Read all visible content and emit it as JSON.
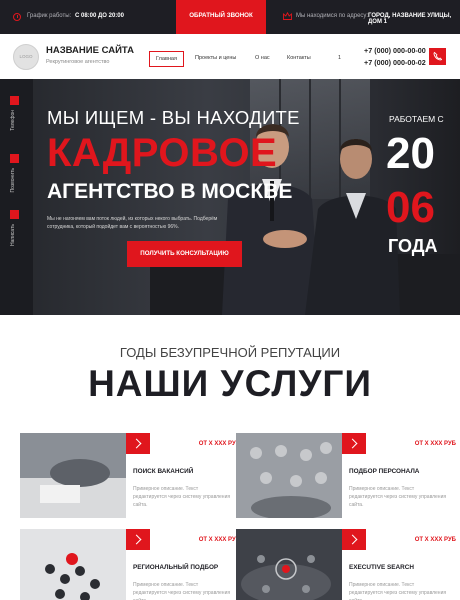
{
  "topbar": {
    "hours_label": "График работы:",
    "hours_value": "С 08:00 ДО 20:00",
    "callback_label": "ОБРАТНЫЙ ЗВОНОК",
    "location_label": "Мы находимся по адресу:",
    "location_value": "ГОРОД, НАЗВАНИЕ УЛИЦЫ, ДОМ 1"
  },
  "header": {
    "logo_text": "LOGO",
    "site_title": "НАЗВАНИЕ САЙТА",
    "site_subtitle": "Рекрутинговое агентство",
    "nav": [
      "Главная",
      "Проекты и цены",
      "О нас",
      "Контакты",
      "1"
    ],
    "phones": [
      "+7 (000) 000-00-00",
      "+7 (000) 000-00-02"
    ]
  },
  "side_rail": [
    "Телефон",
    "Позвонить",
    "Написать"
  ],
  "hero": {
    "line1": "МЫ ИЩЕМ - ВЫ НАХОДИТЕ",
    "line2": "КАДРОВОЕ",
    "line3": "АГЕНТСТВО В МОСКВЕ",
    "description": "Мы не нагоняем вам поток людей, из которых некого выбрать. Подберём сотрудника, который подойдет вам с вероятностью 96%.",
    "cta_label": "ПОЛУЧИТЬ КОНСУЛЬТАЦИЮ",
    "since_label": "РАБОТАЕМ С",
    "since_top": "20",
    "since_bottom": "06",
    "since_suffix": "ГОДА"
  },
  "services": {
    "kicker": "ГОДЫ БЕЗУПРЕЧНОЙ РЕПУТАЦИИ",
    "title": "НАШИ УСЛУГИ",
    "cards": [
      {
        "title": "ПОИСК ВАКАНСИЙ",
        "price": "ОТ Х ХХХ РУБ",
        "desc": "Примерное описание. Текст редактируется через систему управления сайта."
      },
      {
        "title": "ПОДБОР ПЕРСОНАЛА",
        "price": "ОТ Х ХХХ РУБ",
        "desc": "Примерное описание. Текст редактируется через систему управления сайта."
      },
      {
        "title": "РЕГИОНАЛЬНЫЙ ПОДБОР",
        "price": "ОТ Х ХХХ РУБ",
        "desc": "Примерное описание. Текст редактируется через систему управления сайта."
      },
      {
        "title": "EXECUTIVE SEARCH",
        "price": "ОТ Х ХХХ РУБ",
        "desc": "Примерное описание. Текст редактируется через систему управления сайта."
      }
    ]
  },
  "colors": {
    "accent": "#e0161d",
    "dark": "#1e1e24"
  },
  "icons": [
    "clock-icon",
    "crown-icon",
    "phone-icon",
    "arrow-right-icon"
  ]
}
